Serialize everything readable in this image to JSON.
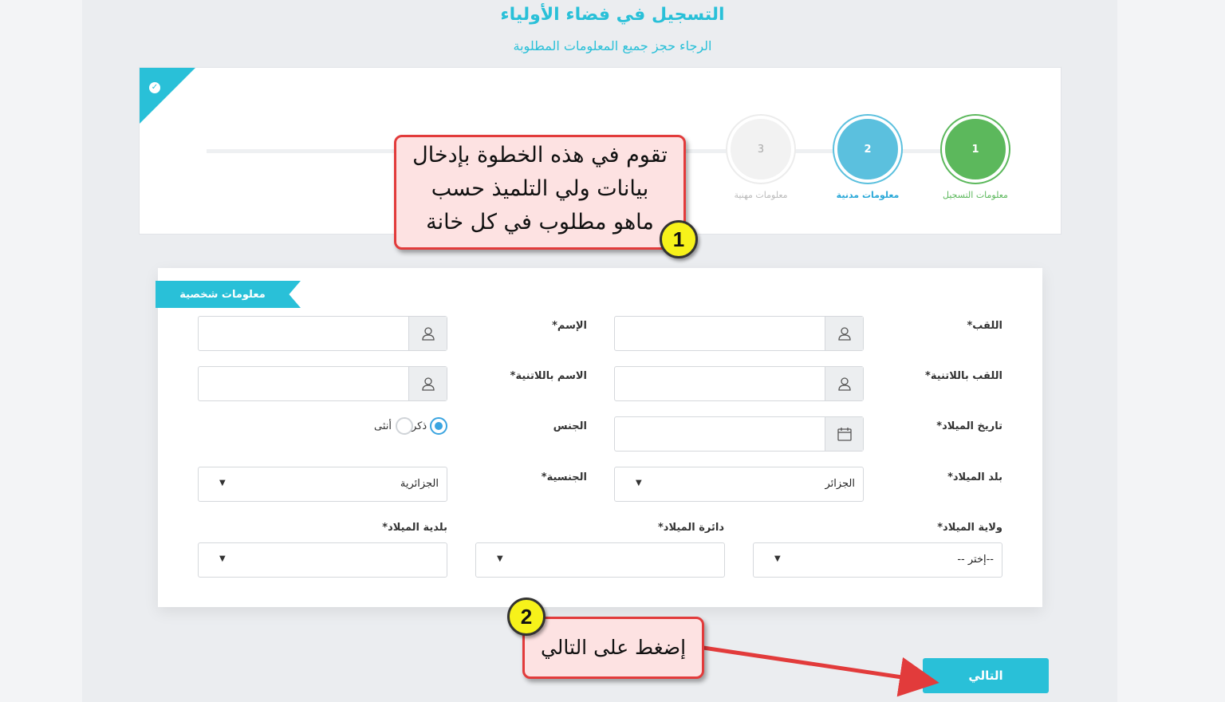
{
  "header": {
    "title": "التسجيل في فضاء الأولياء",
    "subtitle": "الرجاء حجز جميع المعلومات المطلوبة"
  },
  "stepper": {
    "steps": [
      {
        "number": "1",
        "label": "معلومات التسجيل",
        "state": "done"
      },
      {
        "number": "2",
        "label": "معلومات مدنية",
        "state": "active"
      },
      {
        "number": "3",
        "label": "معلومات مهنية",
        "state": "pending"
      }
    ]
  },
  "form": {
    "section_title": "معلومات شخصية",
    "fields": {
      "surname": {
        "label": "اللقب*",
        "value": ""
      },
      "name": {
        "label": "الإسم*",
        "value": ""
      },
      "surname_latin": {
        "label": "اللقب باللاتنية*",
        "value": ""
      },
      "name_latin": {
        "label": "الاسم باللاتنية*",
        "value": ""
      },
      "birth_date": {
        "label": "تاريخ الميلاد*",
        "value": ""
      },
      "gender": {
        "label": "الجنس",
        "options": [
          "ذكر",
          "أنثى"
        ],
        "selected": "ذكر"
      },
      "birth_country": {
        "label": "بلد الميلاد*",
        "value": "الجزائر"
      },
      "nationality": {
        "label": "الجنسية*",
        "value": "الجزائرية"
      },
      "birth_state": {
        "label": "ولاية الميلاد*",
        "value": "--إختر --"
      },
      "birth_district": {
        "label": "دائرة الميلاد*",
        "value": ""
      },
      "birth_municipality": {
        "label": "بلدية الميلاد*",
        "value": ""
      }
    }
  },
  "actions": {
    "next_label": "التالي"
  },
  "annotations": {
    "callout1": {
      "number": "1",
      "lines": [
        "تقوم في هذه الخطوة بإدخال",
        "بيانات ولي التلميذ حسب",
        "ماهو مطلوب في كل خانة"
      ]
    },
    "callout2": {
      "number": "2",
      "text": "إضغط على التالي"
    }
  },
  "colors": {
    "accent": "#29c0d8",
    "step_done": "#5cb85c",
    "step_active": "#5bc0de",
    "callout_border": "#e23b3b",
    "badge": "#f7f21a"
  }
}
